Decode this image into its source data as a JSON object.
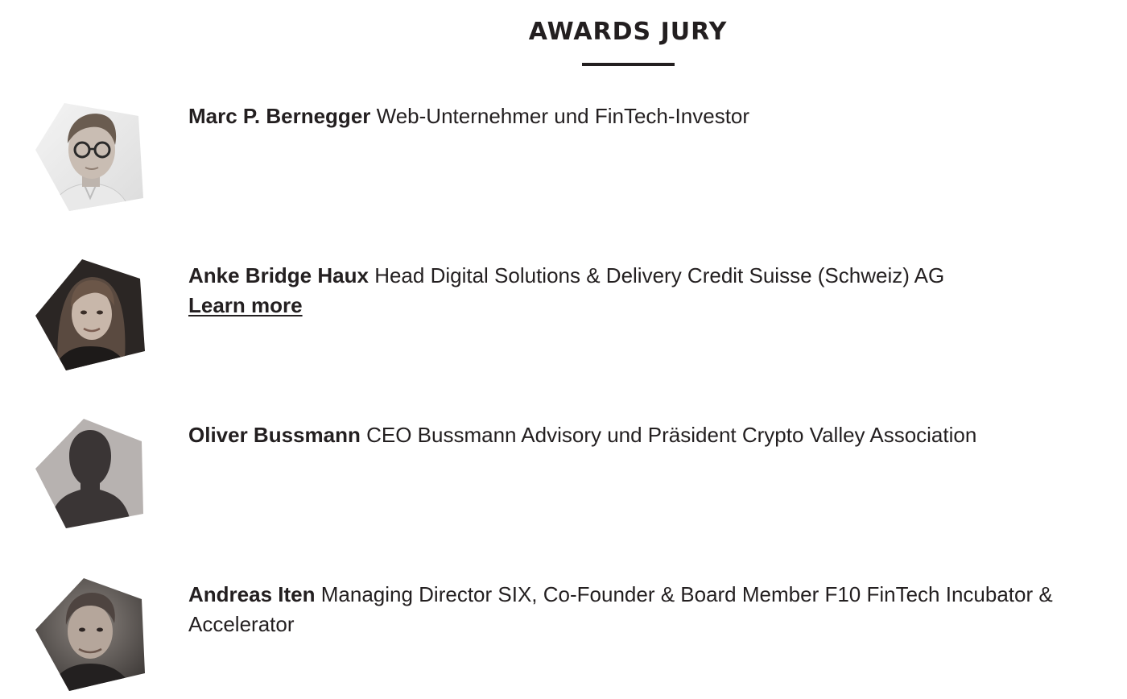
{
  "header": {
    "title": "AWARDS JURY"
  },
  "jury": [
    {
      "name": "Marc P. Bernegger",
      "role": "Web-Unternehmer und FinTech-Investor",
      "photo_icon": "portrait-photo-icon"
    },
    {
      "name": "Anke Bridge Haux",
      "role": "Head Digital Solutions & Delivery Credit Suisse (Schweiz) AG",
      "link": "Learn more",
      "photo_icon": "portrait-photo-icon"
    },
    {
      "name": "Oliver Bussmann",
      "role": "CEO Bussmann Advisory und Präsident Crypto Valley Association",
      "photo_icon": "silhouette-placeholder-icon"
    },
    {
      "name": "Andreas Iten",
      "role": "Managing Director SIX, Co-Founder & Board Member F10 FinTech Incubator & Accelerator",
      "photo_icon": "portrait-photo-icon"
    }
  ],
  "colors": {
    "text": "#231f20",
    "placeholder_bg": "#b7b2b0",
    "silhouette": "#3a3535"
  }
}
